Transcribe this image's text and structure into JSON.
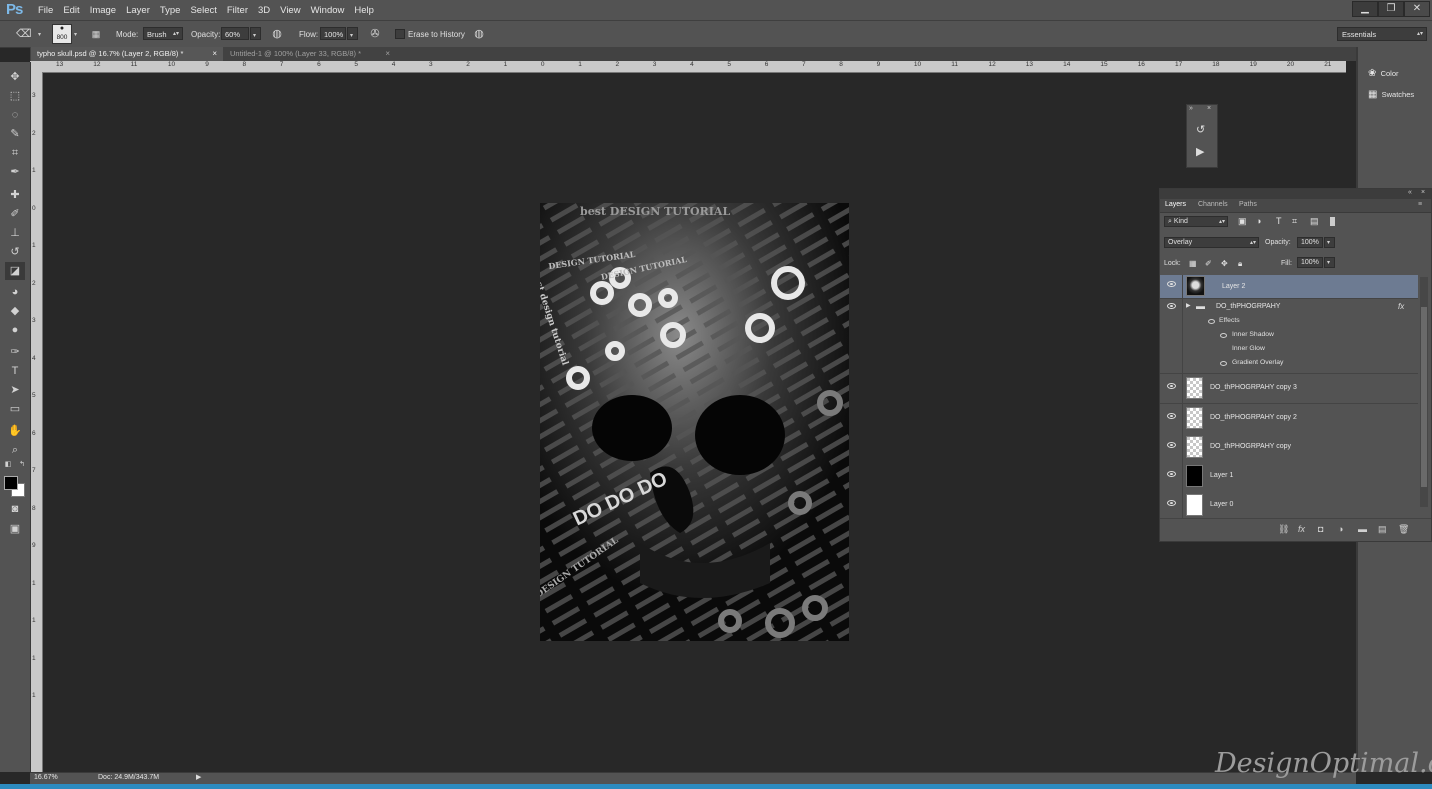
{
  "app": {
    "logo": "Ps",
    "colors": {
      "ui": "#535353",
      "canvas_bg": "#282828",
      "selection": "#6d7b92"
    }
  },
  "menu": [
    "File",
    "Edit",
    "Image",
    "Layer",
    "Type",
    "Select",
    "Filter",
    "3D",
    "View",
    "Window",
    "Help"
  ],
  "window_controls": {
    "minimize": "▁",
    "restore": "❐",
    "close": "✕"
  },
  "options": {
    "brush_size": "800",
    "mode_label": "Mode:",
    "mode_value": "Brush",
    "opacity_label": "Opacity:",
    "opacity_value": "60%",
    "flow_label": "Flow:",
    "flow_value": "100%",
    "erase_history_label": "Erase to History",
    "workspace": "Essentials"
  },
  "tabs": [
    {
      "title": "typho skull.psd @ 16.7% (Layer 2, RGB/8) *",
      "close": "×"
    },
    {
      "title": "Untitled-1 @ 100% (Layer 33, RGB/8) *",
      "close": "×"
    }
  ],
  "ruler_top": [
    "13",
    "12",
    "11",
    "10",
    "9",
    "8",
    "7",
    "6",
    "5",
    "4",
    "3",
    "2",
    "1",
    "0",
    "1",
    "2",
    "3",
    "4",
    "5",
    "6",
    "7",
    "8",
    "9",
    "10",
    "11",
    "12",
    "13",
    "14",
    "15",
    "16",
    "17",
    "18",
    "19",
    "20",
    "21"
  ],
  "ruler_left": [
    "3",
    "2",
    "1",
    "0",
    "1",
    "2",
    "3",
    "4",
    "5",
    "6",
    "7",
    "8",
    "9",
    "1",
    "1",
    "1",
    "1"
  ],
  "dock": {
    "color_label": "Color",
    "swatches_label": "Swatches"
  },
  "layers_panel": {
    "tabs": [
      "Layers",
      "Channels",
      "Paths"
    ],
    "filter_kind": "Kind",
    "blend_mode": "Overlay",
    "opacity_label": "Opacity:",
    "opacity_value": "100%",
    "lock_label": "Lock:",
    "fill_label": "Fill:",
    "fill_value": "100%",
    "layers": [
      {
        "name": "Layer 2",
        "thumb": "skull",
        "selected": true
      },
      {
        "name": "DO_thPHOGRPAHY",
        "group": true,
        "fx": "fx"
      },
      {
        "name": "DO_thPHOGRPAHY copy 3",
        "thumb": "checker"
      },
      {
        "name": "DO_thPHOGRPAHY copy 2",
        "thumb": "checker"
      },
      {
        "name": "DO_thPHOGRPAHY copy",
        "thumb": "checker"
      },
      {
        "name": "Layer 1",
        "thumb": "black"
      },
      {
        "name": "Layer 0",
        "thumb": "white"
      }
    ],
    "effects_label": "Effects",
    "effects": [
      "Inner Shadow",
      "Inner Glow",
      "Gradient Overlay"
    ]
  },
  "artwork_text": {
    "lines": [
      "best DESIGN TUTORIAL",
      "DESIGN TUTORIAL",
      "DESIGN TUTORIAL",
      "best design tutorial",
      "DESIGN TUTORIAL",
      "DO DO DO"
    ]
  },
  "status": {
    "zoom": "16.67%",
    "doc": "Doc: 24.9M/343.7M"
  },
  "watermark": "DesignOptimal.com"
}
